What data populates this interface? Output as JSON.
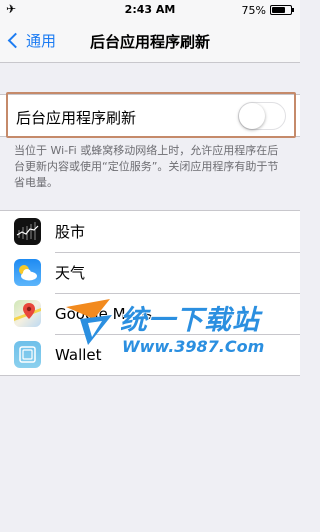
{
  "status_bar": {
    "time": "2:43 AM",
    "battery_percent": "75%",
    "battery_level": 0.75,
    "airplane_icon": "airplane-icon"
  },
  "nav": {
    "back_label": "通用",
    "title": "后台应用程序刷新"
  },
  "toggle": {
    "label": "后台应用程序刷新",
    "state": "off"
  },
  "footer": "当位于 Wi-Fi 或蜂窝移动网络上时，允许应用程序在后台更新内容或使用“定位服务”。关闭应用程序有助于节省电量。",
  "apps": [
    {
      "name": "股市",
      "icon": "stocks-icon"
    },
    {
      "name": "天气",
      "icon": "weather-icon"
    },
    {
      "name": "Google Maps",
      "icon": "google-maps-icon"
    },
    {
      "name": "Wallet",
      "icon": "wallet-icon"
    }
  ],
  "watermark": {
    "title": "统一下载站",
    "url": "Www.3987.Com"
  },
  "colors": {
    "accent": "#1d7cf2",
    "background": "#efeff4",
    "highlight_outline": "#c58a6a",
    "watermark": "#2b8fe0"
  }
}
